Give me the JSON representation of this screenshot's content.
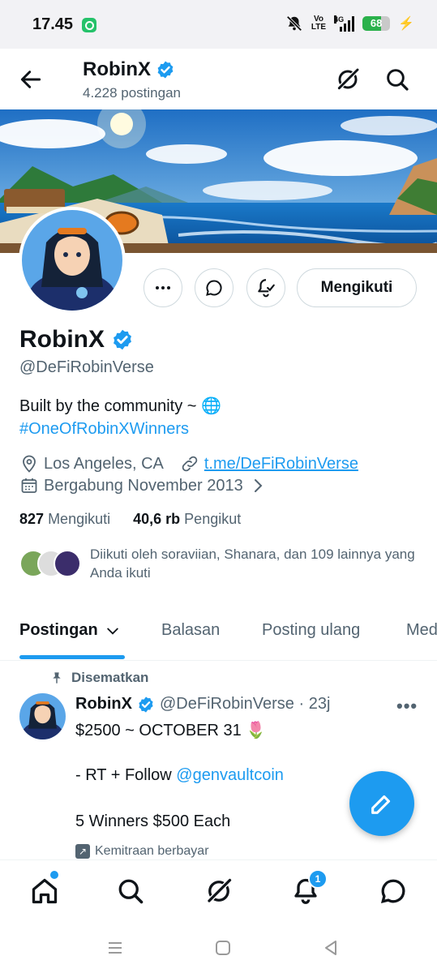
{
  "status_bar": {
    "time": "17.45",
    "volte": "Vo\nLTE",
    "network": "4G",
    "battery": "68",
    "battery_level": 0.68
  },
  "header": {
    "name": "RobinX",
    "post_count": "4.228 postingan",
    "icons": [
      "back-arrow-icon",
      "grok-icon",
      "search-icon"
    ]
  },
  "profile": {
    "name": "RobinX",
    "handle": "@DeFiRobinVerse",
    "bio_text": "Built by the community ~ 🌐",
    "bio_hashtag": "#OneOfRobinXWinners",
    "location": "Los Angeles, CA",
    "link": "t.me/DeFiRobinVerse",
    "joined": "Bergabung November 2013",
    "following_count": "827",
    "following_label": "Mengikuti",
    "followers_count": "40,6 rb",
    "followers_label": "Pengikut",
    "followed_by": "Diikuti oleh soraviian, Shanara, dan 109 lainnya yang Anda ikuti",
    "follow_button": "Mengikuti"
  },
  "tabs": [
    {
      "label": "Postingan",
      "active": true
    },
    {
      "label": "Balasan"
    },
    {
      "label": "Posting ulang"
    },
    {
      "label": "Media"
    }
  ],
  "pinned_post": {
    "pinned_label": "Disematkan",
    "author": "RobinX",
    "handle_time": "@DeFiRobinVerse · 23j",
    "line1": "$2500 ~ OCTOBER 31 🌷",
    "line2_prefix": "- RT + Follow ",
    "line2_mention": "@genvaultcoin",
    "line3": "5 Winners $500 Each",
    "paid_label": "Kemitraan berbayar"
  },
  "bottom_nav": {
    "items": [
      "home-icon",
      "search-icon",
      "grok-icon",
      "notifications-icon",
      "messages-icon"
    ],
    "notification_badge": "1"
  },
  "colors": {
    "accent": "#1d9bf0",
    "text": "#0f1419",
    "secondary": "#536471"
  }
}
